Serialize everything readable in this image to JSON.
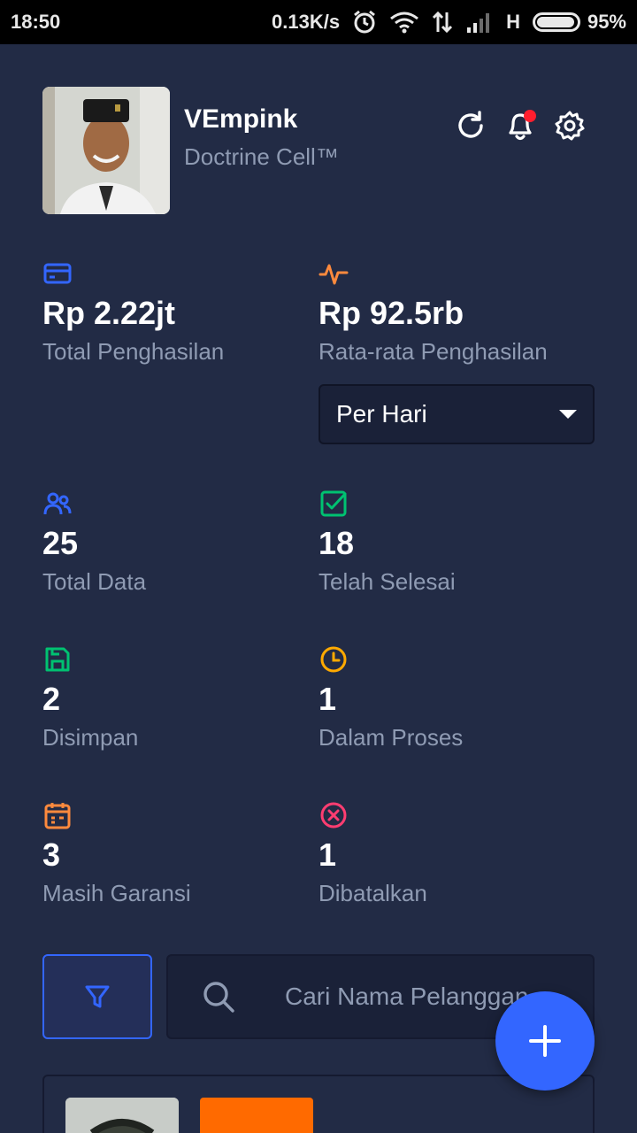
{
  "status_bar": {
    "time": "18:50",
    "network_speed": "0.13K/s",
    "network_type": "H",
    "battery": "95%",
    "battery_level": 0.95,
    "icons": [
      "alarm-icon",
      "wifi-icon",
      "data-transfer-icon",
      "signal-icon",
      "battery-icon"
    ]
  },
  "header": {
    "username": "VEmpink",
    "shop_name": "Doctrine Cell™",
    "actions": [
      "refresh-icon",
      "notification-icon",
      "settings-icon"
    ],
    "notification_dot_color": "#ff1e2e"
  },
  "stats": {
    "total_income": {
      "value": "Rp 2.22jt",
      "label": "Total Penghasilan",
      "icon": "credit-card-icon",
      "color": "#3366ff"
    },
    "avg_income": {
      "value": "Rp 92.5rb",
      "label": "Rata-rata Penghasilan",
      "icon": "activity-icon",
      "color": "#ff8a3d"
    },
    "period_select": {
      "selected": "Per Hari"
    },
    "total_data": {
      "value": "25",
      "label": "Total Data",
      "icon": "people-icon",
      "color": "#3366ff"
    },
    "completed": {
      "value": "18",
      "label": "Telah Selesai",
      "icon": "checkbox-icon",
      "color": "#00c271"
    },
    "saved": {
      "value": "2",
      "label": "Disimpan",
      "icon": "save-icon",
      "color": "#00c271"
    },
    "in_process": {
      "value": "1",
      "label": "Dalam Proses",
      "icon": "clock-icon",
      "color": "#ffaa00"
    },
    "warranty": {
      "value": "3",
      "label": "Masih Garansi",
      "icon": "calendar-icon",
      "color": "#ff8a3d"
    },
    "cancelled": {
      "value": "1",
      "label": "Dibatalkan",
      "icon": "close-circle-icon",
      "color": "#ff3d71"
    }
  },
  "search": {
    "placeholder": "Cari Nama Pelanggan",
    "filter_icon": "funnel-icon",
    "search_icon": "search-icon"
  },
  "fab": {
    "icon": "plus-icon"
  },
  "colors": {
    "background": "#222b45",
    "accent": "#3366ff",
    "muted_text": "#8f9bb3",
    "card_badge": "#ff6a00"
  }
}
